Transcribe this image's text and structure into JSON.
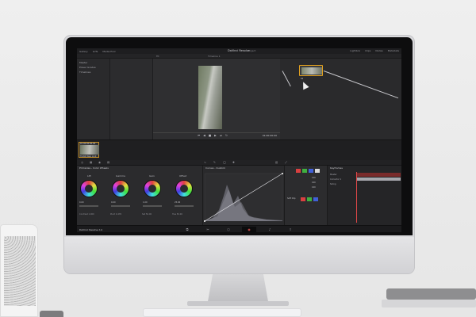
{
  "app": {
    "title": "DaVinci Resolve",
    "project": "Project",
    "top_menu": [
      "Gallery",
      "LUTs",
      "Media Pool"
    ],
    "top_right": [
      "Lightbox",
      "Clips",
      "Nodes",
      "Metadata"
    ]
  },
  "media_pool": {
    "items": [
      "Master",
      "Power Grades",
      "Timelines"
    ]
  },
  "viewer": {
    "timeline_name": "Timeline 1",
    "timecode": "01:00:00:00",
    "header_left": "Fit",
    "transport": [
      "⏮",
      "◀",
      "■",
      "▶",
      "⏭",
      "↻"
    ]
  },
  "nodes": {
    "node_label": "01"
  },
  "clip_strip": {
    "clip_id": "01  00:00:00:00",
    "clip_name": "H.264 Main L4.0"
  },
  "color_wheels": {
    "title": "Primaries - Color Wheels",
    "wheels": [
      {
        "label": "Lift",
        "values": [
          "0.00",
          "0.00",
          "0.00",
          "0.00"
        ]
      },
      {
        "label": "Gamma",
        "values": [
          "0.00",
          "0.00",
          "0.00",
          "0.00"
        ]
      },
      {
        "label": "Gain",
        "values": [
          "1.00",
          "1.00",
          "1.00",
          "1.00"
        ]
      },
      {
        "label": "Offset",
        "values": [
          "25.00",
          "25.00",
          "25.00",
          "25.00"
        ]
      }
    ],
    "bottom_values": [
      "Contrast 1.000",
      "Pivot 0.435",
      "Sat 50.00",
      "Hue 50.00"
    ]
  },
  "curves": {
    "title": "Curves - Custom"
  },
  "rgb_panel": {
    "labels": [
      "100",
      "100",
      "100"
    ],
    "soft_clip": "Soft Clip",
    "swatch_colors": [
      "#d94040",
      "#40b040",
      "#4060d8",
      "#d9d9d9"
    ]
  },
  "keyframes": {
    "title": "Keyframes",
    "rows": [
      "Master",
      "Corrector 1",
      "Sizing"
    ]
  },
  "status": {
    "logo_text": "DaVinci Resolve 14"
  },
  "pages": [
    "⧉",
    "✂",
    "⬡",
    "◉",
    "♪",
    "⇪"
  ]
}
